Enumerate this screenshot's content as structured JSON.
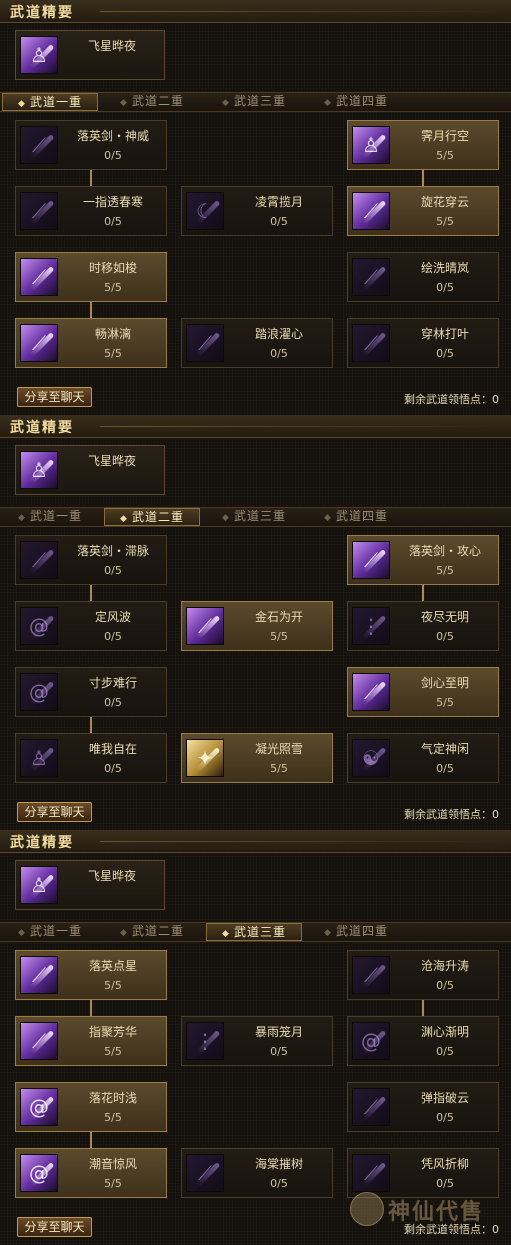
{
  "essence_title": "武道精要",
  "essence_skill": "飞星晔夜",
  "tabs": [
    "武道一重",
    "武道二重",
    "武道三重",
    "武道四重"
  ],
  "share_label": "分享至聊天",
  "remaining_label": "剩余武道领悟点：0",
  "watermark": "神仙代售",
  "panels": [
    {
      "active_tab": 0,
      "nodes": [
        {
          "name": "落英剑・神威",
          "level": "0/5",
          "lit": false,
          "icon": "sword-slash-icon"
        },
        {
          "name": "霁月行空",
          "level": "5/5",
          "lit": true,
          "icon": "figure-icon"
        },
        {
          "name": "一指透春寒",
          "level": "0/5",
          "lit": false,
          "icon": "sword-slash-icon"
        },
        {
          "name": "凌霄揽月",
          "level": "0/5",
          "lit": false,
          "icon": "moon-icon"
        },
        {
          "name": "旋花穿云",
          "level": "5/5",
          "lit": true,
          "icon": "sword-slash-icon"
        },
        {
          "name": "时移如梭",
          "level": "5/5",
          "lit": true,
          "icon": "sword-slash-icon"
        },
        {
          "name": "绘洗晴岚",
          "level": "0/5",
          "lit": false,
          "icon": "sword-slash-icon"
        },
        {
          "name": "畅淋漓",
          "level": "5/5",
          "lit": true,
          "icon": "sword-slash-icon"
        },
        {
          "name": "踏浪濯心",
          "level": "0/5",
          "lit": false,
          "icon": "sword-slash-icon"
        },
        {
          "name": "穿林打叶",
          "level": "0/5",
          "lit": false,
          "icon": "sword-slash-icon"
        }
      ]
    },
    {
      "active_tab": 1,
      "nodes": [
        {
          "name": "落英剑・滞脉",
          "level": "0/5",
          "lit": false,
          "icon": "sword-slash-icon"
        },
        {
          "name": "落英剑・攻心",
          "level": "5/5",
          "lit": true,
          "icon": "sword-slash-icon"
        },
        {
          "name": "定风波",
          "level": "0/5",
          "lit": false,
          "icon": "swirl-icon"
        },
        {
          "name": "金石为开",
          "level": "5/5",
          "lit": true,
          "icon": "sword-slash-icon"
        },
        {
          "name": "夜尽无明",
          "level": "0/5",
          "lit": false,
          "icon": "rain-icon"
        },
        {
          "name": "寸步难行",
          "level": "0/5",
          "lit": false,
          "icon": "swirl-icon"
        },
        {
          "name": "剑心至明",
          "level": "5/5",
          "lit": true,
          "icon": "sword-slash-icon"
        },
        {
          "name": "唯我自在",
          "level": "0/5",
          "lit": false,
          "icon": "figure-icon"
        },
        {
          "name": "凝光照雪",
          "level": "5/5",
          "lit": true,
          "icon": "light-burst-icon"
        },
        {
          "name": "气定神闲",
          "level": "0/5",
          "lit": false,
          "icon": "meditation-icon"
        }
      ]
    },
    {
      "active_tab": 2,
      "nodes": [
        {
          "name": "落英点星",
          "level": "5/5",
          "lit": true,
          "icon": "sword-slash-icon"
        },
        {
          "name": "沧海升涛",
          "level": "0/5",
          "lit": false,
          "icon": "sword-slash-icon"
        },
        {
          "name": "指聚芳华",
          "level": "5/5",
          "lit": true,
          "icon": "sword-slash-icon"
        },
        {
          "name": "暴雨笼月",
          "level": "0/5",
          "lit": false,
          "icon": "rain-icon"
        },
        {
          "name": "渊心渐明",
          "level": "0/5",
          "lit": false,
          "icon": "swirl-icon"
        },
        {
          "name": "落花时浅",
          "level": "5/5",
          "lit": true,
          "icon": "swirl-icon"
        },
        {
          "name": "弹指破云",
          "level": "0/5",
          "lit": false,
          "icon": "sword-slash-icon"
        },
        {
          "name": "潮音惊风",
          "level": "5/5",
          "lit": true,
          "icon": "swirl-icon"
        },
        {
          "name": "海棠摧树",
          "level": "0/5",
          "lit": false,
          "icon": "sword-slash-icon"
        },
        {
          "name": "凭风折柳",
          "level": "0/5",
          "lit": false,
          "icon": "sword-slash-icon"
        }
      ]
    }
  ]
}
